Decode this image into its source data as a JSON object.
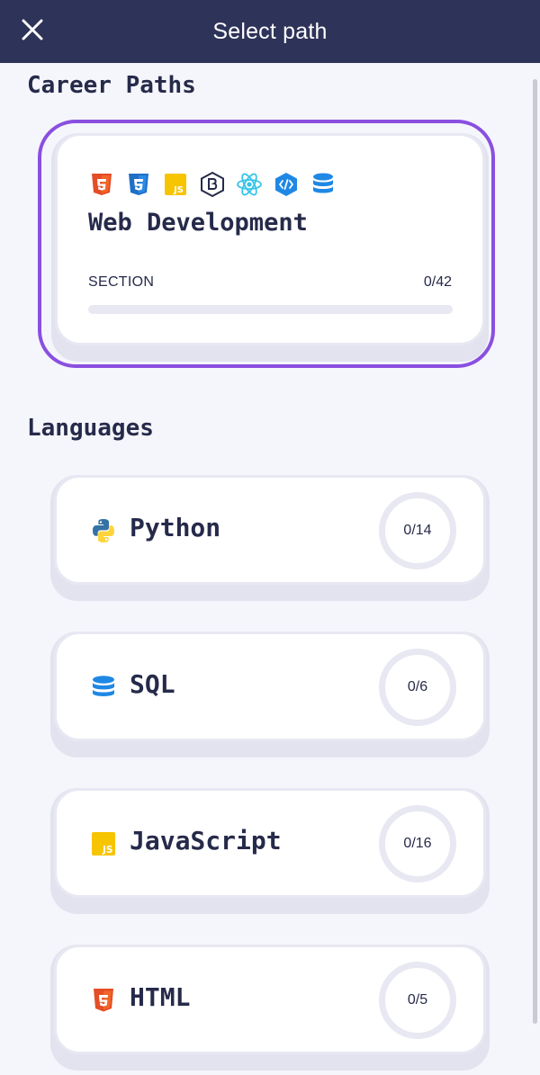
{
  "topbar": {
    "title": "Select path",
    "close_icon": "close-icon"
  },
  "career_paths": {
    "heading": "Career Paths",
    "items": [
      {
        "title": "Web Development",
        "icons": [
          "html5-icon",
          "css3-icon",
          "javascript-icon",
          "bootstrap-icon",
          "react-icon",
          "code-icon",
          "database-icon"
        ],
        "section_label": "SECTION",
        "progress_text": "0/42",
        "progress_fraction": 0,
        "selected": true
      }
    ]
  },
  "languages": {
    "heading": "Languages",
    "items": [
      {
        "name": "Python",
        "icon": "python-icon",
        "progress_text": "0/14",
        "progress_fraction": 0
      },
      {
        "name": "SQL",
        "icon": "database-icon",
        "progress_text": "0/6",
        "progress_fraction": 0
      },
      {
        "name": "JavaScript",
        "icon": "javascript-icon",
        "progress_text": "0/16",
        "progress_fraction": 0
      },
      {
        "name": "HTML",
        "icon": "html5-icon",
        "progress_text": "0/5",
        "progress_fraction": 0
      }
    ]
  },
  "colors": {
    "header_bg": "#2e3359",
    "selected_border": "#8a4fe0",
    "text_primary": "#262a4a",
    "ring_track": "#e7e8f2",
    "html_orange": "#e44d26",
    "css_blue": "#1f88e5",
    "js_yellow": "#f7c400",
    "react_cyan": "#35c5e8",
    "python_blue": "#3572a5",
    "python_yellow": "#ffd43b"
  }
}
